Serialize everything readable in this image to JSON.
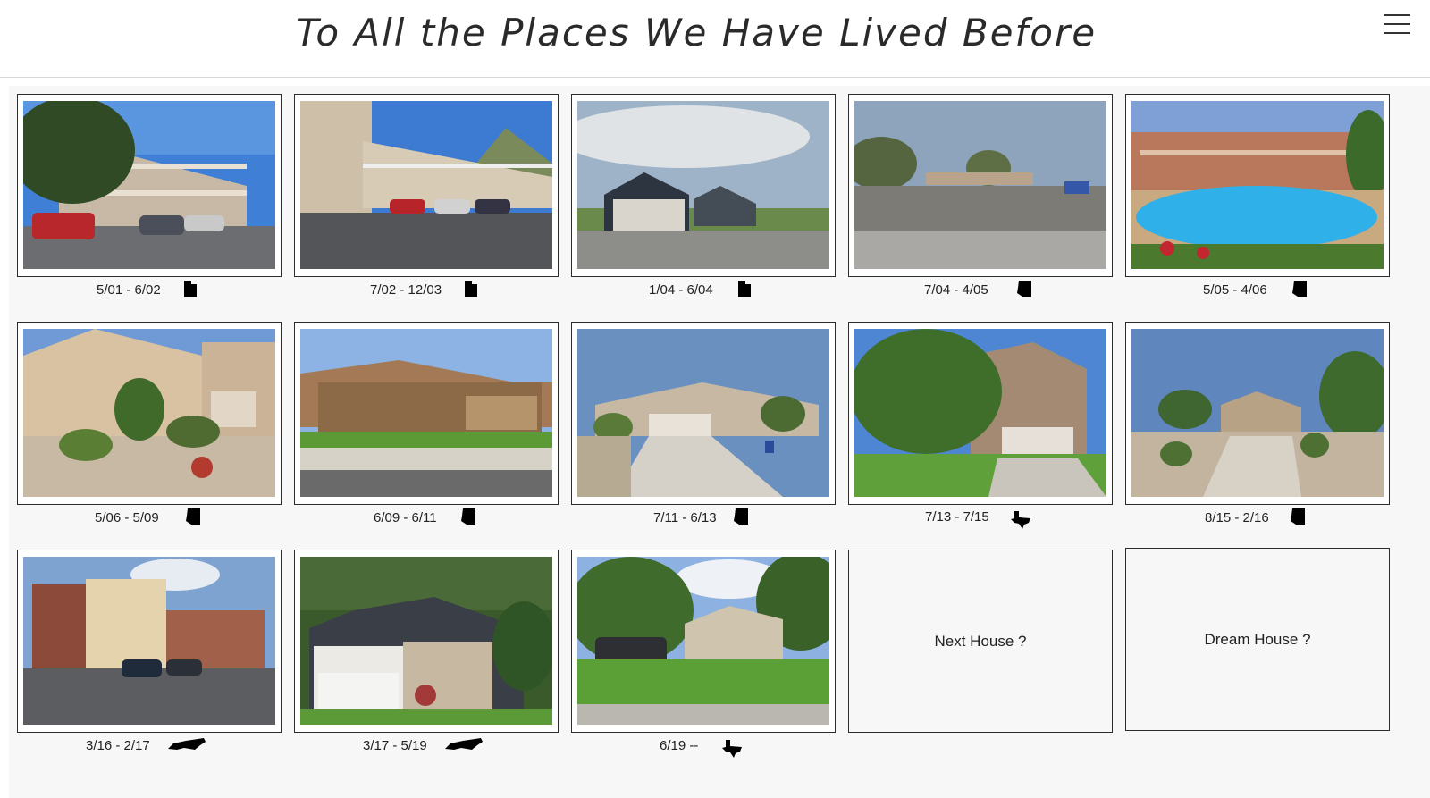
{
  "page": {
    "title": "To All the Places We Have Lived Before",
    "menu_icon": "hamburger-menu-icon"
  },
  "homes": [
    {
      "dates": "5/01 - 6/02",
      "state_icon": "utah-state-icon",
      "photo": "apartment-complex-photo"
    },
    {
      "dates": "7/02 - 12/03",
      "state_icon": "utah-state-icon",
      "photo": "apartment-building-mountains-photo"
    },
    {
      "dates": "1/04 - 6/04",
      "state_icon": "utah-state-icon",
      "photo": "house-cloudy-sky-photo"
    },
    {
      "dates": "7/04 - 4/05",
      "state_icon": "arizona-state-icon",
      "photo": "parking-lot-carports-photo"
    },
    {
      "dates": "5/05 - 4/06",
      "state_icon": "arizona-state-icon",
      "photo": "apartment-pool-photo"
    },
    {
      "dates": "5/06 - 5/09",
      "state_icon": "arizona-state-icon",
      "photo": "stucco-house-tree-photo"
    },
    {
      "dates": "6/09 - 6/11",
      "state_icon": "arizona-state-icon",
      "photo": "single-story-house-photo"
    },
    {
      "dates": "7/11 - 6/13",
      "state_icon": "arizona-state-icon",
      "photo": "house-driveway-sign-photo"
    },
    {
      "dates": "7/13 - 7/15",
      "state_icon": "texas-state-icon",
      "photo": "two-story-brick-house-photo"
    },
    {
      "dates": "8/15 - 2/16",
      "state_icon": "arizona-state-icon",
      "photo": "desert-house-photo"
    },
    {
      "dates": "3/16 - 2/17",
      "state_icon": "north-carolina-state-icon",
      "photo": "brick-apartments-photo"
    },
    {
      "dates": "3/17 - 5/19",
      "state_icon": "north-carolina-state-icon",
      "photo": "craftsman-house-photo"
    },
    {
      "dates": "6/19 --",
      "state_icon": "texas-state-icon",
      "photo": "stone-house-truck-photo"
    }
  ],
  "future": [
    {
      "label": "Next House ?"
    },
    {
      "label": "Dream House ?"
    }
  ]
}
